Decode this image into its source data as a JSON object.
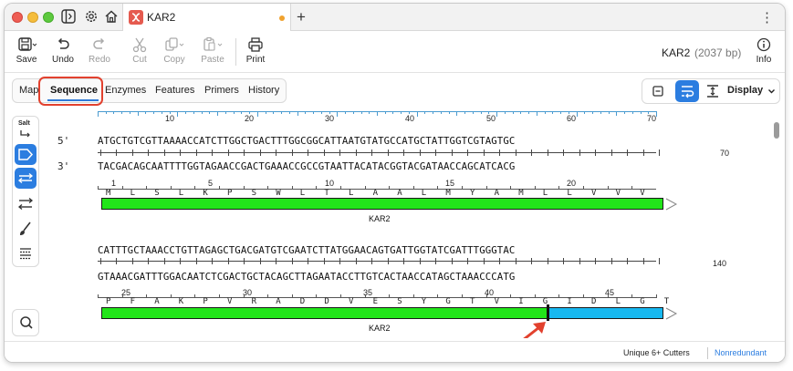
{
  "titlebar": {
    "tab_title": "KAR2",
    "new_tab": "+",
    "menu": "⋮"
  },
  "toolbar": {
    "save": "Save",
    "undo": "Undo",
    "redo": "Redo",
    "cut": "Cut",
    "copy": "Copy",
    "paste": "Paste",
    "print": "Print",
    "info": "Info",
    "doc_name": "KAR2",
    "doc_size": "(2037 bp)"
  },
  "view_tabs": [
    "Map",
    "Sequence",
    "Enzymes",
    "Features",
    "Primers",
    "History"
  ],
  "display_label": "Display",
  "side_tools": {
    "salt": "Salt"
  },
  "sequence": {
    "five_prime": "5'",
    "three_prime": "3'",
    "block1": {
      "ruler": [
        "10",
        "20",
        "30",
        "40",
        "50",
        "60",
        "70"
      ],
      "top": "ATGCTGTCGTTAAAACCATCTTGGCTGACTTTGGCGGCATTAATGTATGCCATGCTATTGGTCGTAGTGC",
      "bottom": "TACGACAGCAATTTTGGTAGAACCGACTGAAACCGCCGTAATTACATACGGTACGATAACCAGCATCACG",
      "end": "70",
      "aa_nums": [
        "1",
        "5",
        "10",
        "15",
        "20"
      ],
      "aa": "M L S L K P S W L T L A A L M Y A M L L V V V",
      "feature": "KAR2"
    },
    "block2": {
      "top": "CATTTGCTAAACCTGTTAGAGCTGACGATGTCGAATCTTATGGAACAGTGATTGGTATCGATTTGGGTAC",
      "bottom": "GTAAACGATTTGGACAATCTCGACTGCTACAGCTTAGAATACCTTGTCACTAACCATAGCTAAACCCATG",
      "end": "140",
      "aa_nums": [
        "25",
        "30",
        "35",
        "40",
        "45"
      ],
      "aa": "P F A K P V R A D D V E S Y G T V I G I D L G T",
      "feature": "KAR2"
    }
  },
  "status": {
    "cutters": "Unique 6+ Cutters",
    "mode": "Nonredundant"
  },
  "colors": {
    "accent": "#2b7de0",
    "feature_green": "#22e51a",
    "feature_cyan": "#17b8f0",
    "highlight": "#e2412e"
  }
}
